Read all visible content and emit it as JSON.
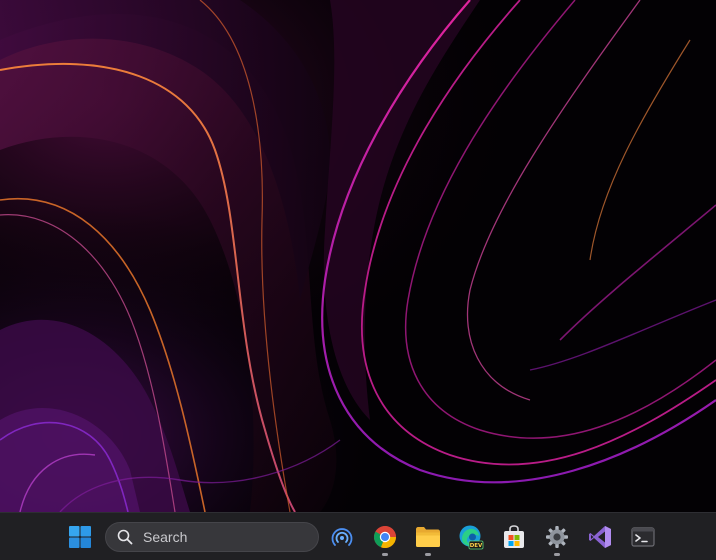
{
  "taskbar": {
    "search": {
      "placeholder": "Search"
    },
    "items": [
      {
        "name": "start",
        "icon": "windows-logo-icon",
        "running": false
      },
      {
        "name": "remote",
        "icon": "broadcast-icon",
        "running": false
      },
      {
        "name": "chrome",
        "icon": "chrome-icon",
        "running": true
      },
      {
        "name": "file-explorer",
        "icon": "folder-icon",
        "running": true
      },
      {
        "name": "edge-dev",
        "icon": "edge-dev-icon",
        "running": false
      },
      {
        "name": "microsoft-store",
        "icon": "store-icon",
        "running": false
      },
      {
        "name": "settings",
        "icon": "gear-icon",
        "running": true
      },
      {
        "name": "visual-studio",
        "icon": "visual-studio-icon",
        "running": false
      },
      {
        "name": "terminal",
        "icon": "terminal-icon",
        "running": false
      }
    ],
    "edge_badge": "DEV"
  },
  "colors": {
    "taskbar_bg": "#202023",
    "wallpaper_magenta": "#d61c9a",
    "wallpaper_orange": "#e8762a",
    "wallpaper_purple": "#6a1a6e"
  }
}
